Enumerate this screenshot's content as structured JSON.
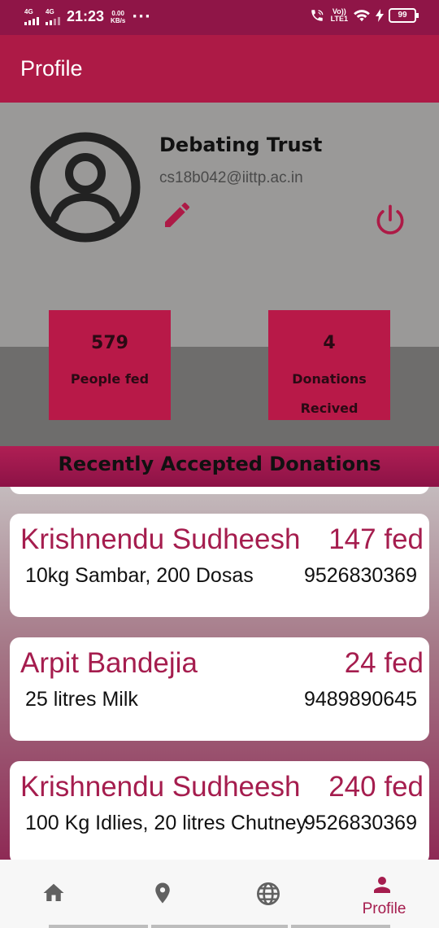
{
  "status_bar": {
    "network1": "4G",
    "network2": "4G",
    "time": "21:23",
    "speed_value": "0.00",
    "speed_unit": "KB/s",
    "overflow": "···",
    "volte_top": "Vo))",
    "volte_bottom": "LTE1",
    "battery": "99"
  },
  "app_bar": {
    "title": "Profile"
  },
  "profile": {
    "name": "Debating Trust",
    "email": "cs18b042@iittp.ac.in",
    "icons": {
      "avatar": "account-circle-icon",
      "edit": "pencil-icon",
      "logout": "power-icon"
    }
  },
  "stats": [
    {
      "value": "579",
      "label": "People fed"
    },
    {
      "value": "4",
      "label_line1": "Donations",
      "label_line2": "Recived"
    }
  ],
  "section": {
    "title": "Recently Accepted Donations"
  },
  "donations": [
    {
      "name": "Krishnendu Sudheesh",
      "fed": "147 fed",
      "items": "10kg Sambar,  200 Dosas",
      "phone": "9526830369"
    },
    {
      "name": "Arpit Bandejia",
      "fed": "24 fed",
      "items": "25 litres Milk",
      "phone": "9489890645"
    },
    {
      "name": "Krishnendu Sudheesh",
      "fed": "240 fed",
      "items": "100 Kg Idlies,  20 litres Chutney",
      "phone": "9526830369"
    }
  ],
  "bottom_nav": {
    "items": [
      {
        "icon": "home-icon"
      },
      {
        "icon": "location-pin-icon"
      },
      {
        "icon": "globe-icon"
      },
      {
        "icon": "person-icon",
        "label": "Profile",
        "active": true
      }
    ]
  },
  "colors": {
    "status_bar": "#8f1547",
    "app_bar": "#ad1a46",
    "accent": "#a51d4e",
    "stat_box": "#b81948"
  }
}
